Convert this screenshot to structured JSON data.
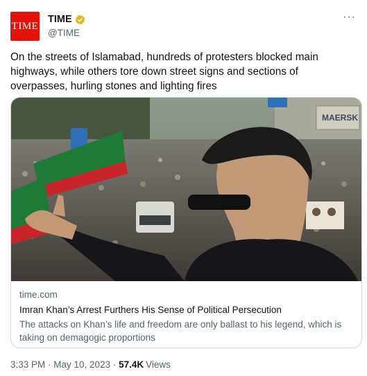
{
  "account": {
    "avatar_text": "TIME",
    "display_name": "TIME",
    "handle": "@TIME"
  },
  "menu": {
    "more_label": "···"
  },
  "tweet": {
    "text": "On the streets of Islamabad, hundreds of protesters blocked main highways, while others tore down street signs and sections of overpasses, hurling stones and lighting fires"
  },
  "card": {
    "domain": "time.com",
    "title": "Imran Khan’s Arrest Furthers His Sense of Political Persecution",
    "description": "The attacks on Khan’s life and freedom are only ballast to his legend, which is taking on demagogic proportions",
    "image_sign_text": "MAERSK"
  },
  "footer": {
    "time": "3:33 PM",
    "separator": " · ",
    "date": "May 10, 2023",
    "views_count": "57.4K",
    "views_label": "Views"
  },
  "colors": {
    "brand_red": "#e3120b",
    "verified_gold": "#e2b719",
    "muted_text": "#536471",
    "border": "#cfd9de"
  }
}
